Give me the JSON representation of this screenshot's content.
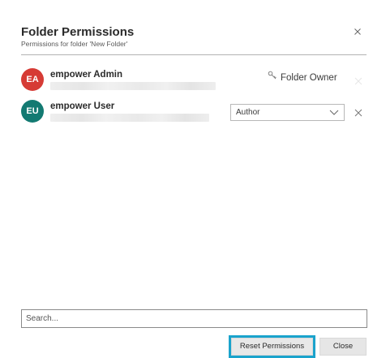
{
  "dialog": {
    "title": "Folder Permissions",
    "subtitle": "Permissions for folder 'New Folder'"
  },
  "icons": {
    "close": "close-icon",
    "owner": "key-icon",
    "remove": "close-icon",
    "chevron": "chevron-down-icon"
  },
  "users": [
    {
      "initials": "EA",
      "name": "empower Admin",
      "avatar_color": "#d63b35",
      "role_label": "Folder Owner",
      "role_editable": false
    },
    {
      "initials": "EU",
      "name": "empower User",
      "avatar_color": "#137a72",
      "role_value": "Author",
      "role_editable": true
    }
  ],
  "search": {
    "placeholder": "Search..."
  },
  "buttons": {
    "reset_label": "Reset Permissions",
    "close_label": "Close"
  },
  "colors": {
    "focus_outline": "#1aa3cc",
    "button_bg": "#e6e6e6"
  }
}
